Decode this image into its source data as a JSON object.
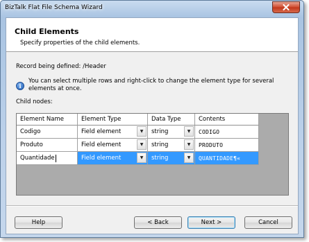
{
  "window": {
    "title": "BizTalk Flat File Schema Wizard"
  },
  "header": {
    "title": "Child Elements",
    "subtitle": "Specify properties of the child elements."
  },
  "record": {
    "label": "Record being defined: /Header"
  },
  "info": {
    "text": "You can select multiple rows and right-click to change the element type for several elements at once."
  },
  "child_nodes": {
    "label": "Child nodes:"
  },
  "grid": {
    "columns": [
      "Element Name",
      "Element Type",
      "Data Type",
      "Contents"
    ],
    "rows": [
      {
        "name": "Codigo",
        "type": "Field element",
        "data_type": "string",
        "contents": "CODIGO"
      },
      {
        "name": "Produto",
        "type": "Field element",
        "data_type": "string",
        "contents": "PRODUTO"
      },
      {
        "name": "Quantidade",
        "type": "Field element",
        "data_type": "string",
        "contents": "QUANTIDADE¶«"
      }
    ],
    "selected_row": 2
  },
  "buttons": {
    "help": "Help",
    "back": "< Back",
    "next": "Next >",
    "cancel": "Cancel"
  },
  "icons": {
    "close": "close-icon",
    "info": "info-icon",
    "dropdown": "chevron-down-icon"
  },
  "colors": {
    "selection": "#3399ff",
    "close_button": "#c1361a"
  }
}
